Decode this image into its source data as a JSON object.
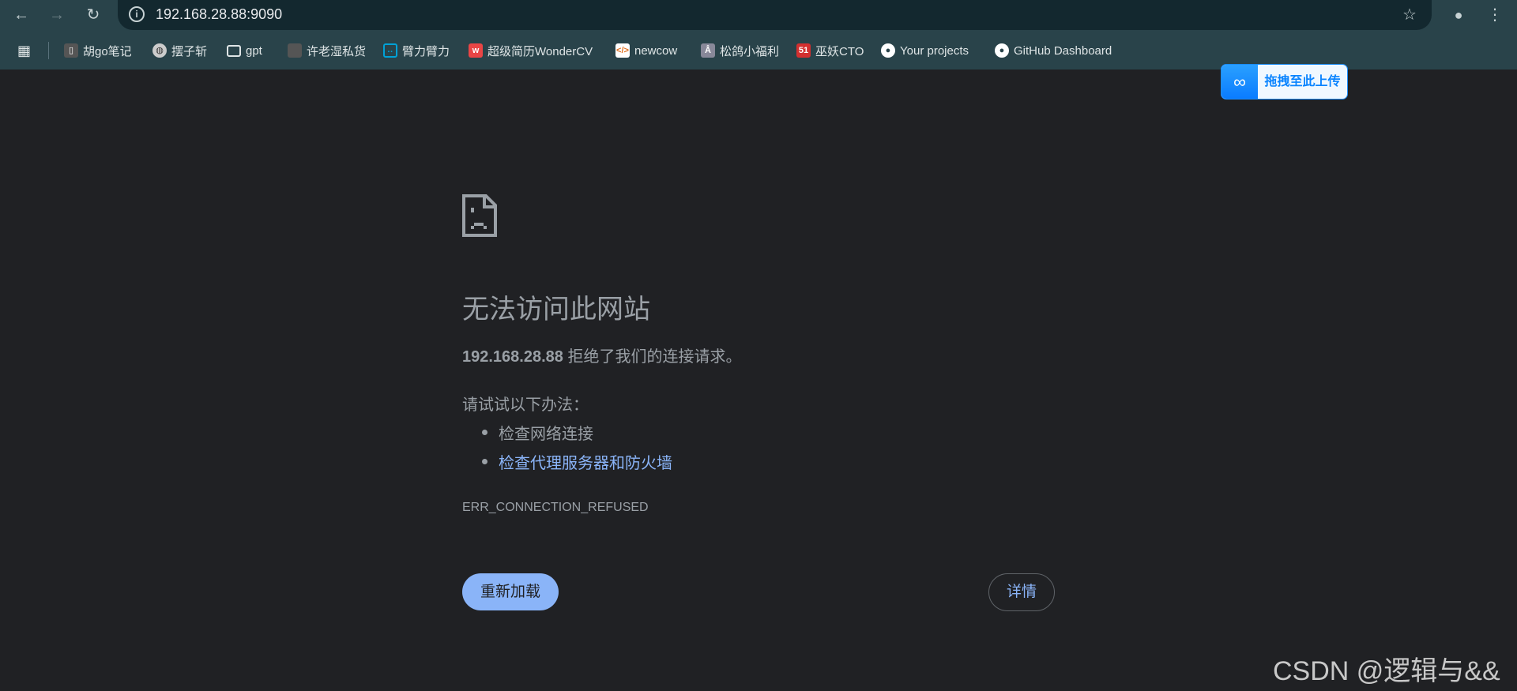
{
  "browser": {
    "url": "192.168.28.88:9090",
    "bookmarks": [
      {
        "label": "胡go笔记",
        "icon": "book-icon"
      },
      {
        "label": "摆子斩",
        "icon": "globe-icon"
      },
      {
        "label": "gpt",
        "icon": "folder-icon"
      },
      {
        "label": "许老湿私货",
        "icon": "folder-icon"
      },
      {
        "label": "臂力臂力",
        "icon": "bilibili-icon"
      },
      {
        "label": "超级简历WonderCV",
        "icon": "wondercv-icon"
      },
      {
        "label": "newcow",
        "icon": "newcow-icon"
      },
      {
        "label": "松鸽小福利",
        "icon": "site-icon"
      },
      {
        "label": "巫妖CTO",
        "icon": "51cto-icon"
      },
      {
        "label": "Your projects",
        "icon": "github-icon"
      },
      {
        "label": "GitHub Dashboard",
        "icon": "github-icon"
      }
    ]
  },
  "upload_widget": {
    "label": "拖拽至此上传",
    "color": "#0a84ff"
  },
  "error_page": {
    "title": "无法访问此网站",
    "host": "192.168.28.88",
    "message": "拒绝了我们的连接请求。",
    "try_label": "请试试以下办法：",
    "suggestions": [
      "检查网络连接",
      "检查代理服务器和防火墙"
    ],
    "error_code": "ERR_CONNECTION_REFUSED",
    "reload_label": "重新加载",
    "details_label": "详情",
    "link_color": "#8ab4f8"
  },
  "watermark": "CSDN @逻辑与&&"
}
